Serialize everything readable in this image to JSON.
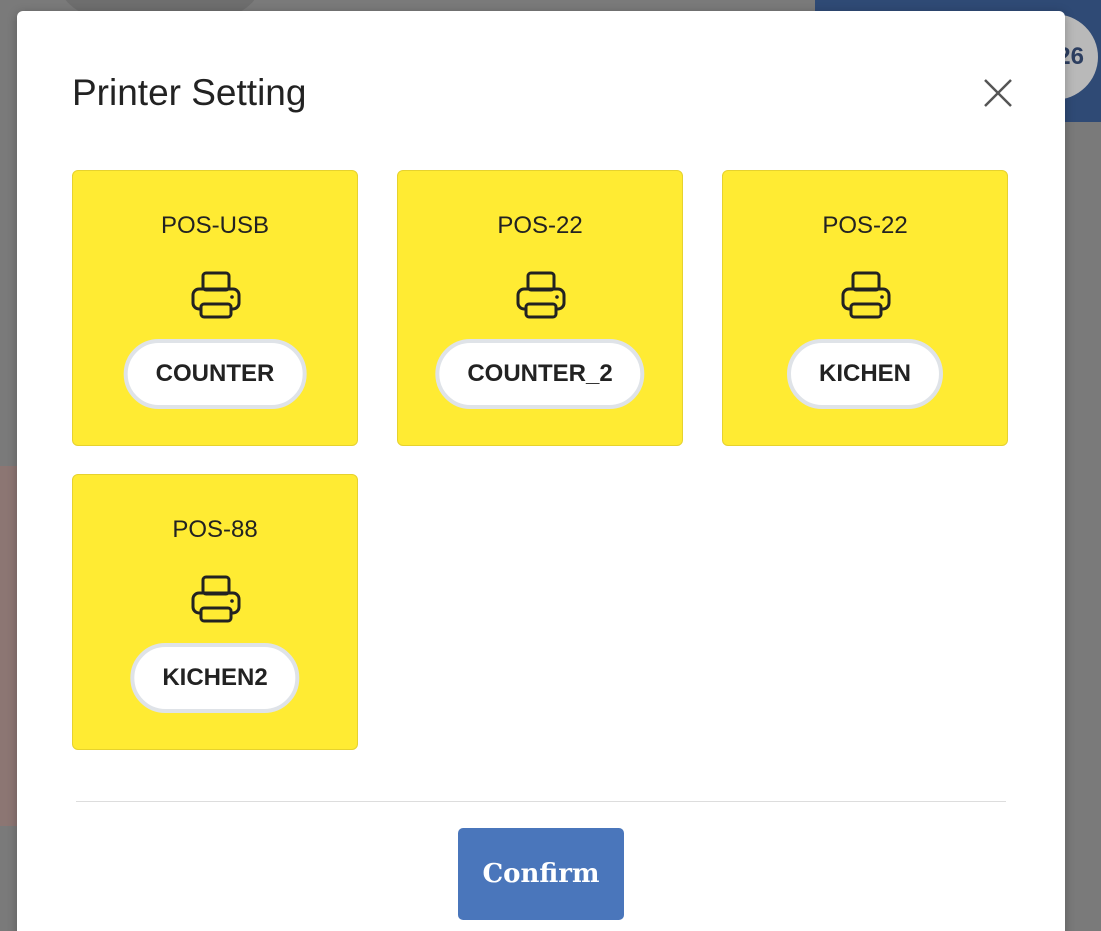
{
  "modal": {
    "title": "Printer Setting",
    "confirm_label": "Confirm"
  },
  "background": {
    "badge_text": "26"
  },
  "printers": [
    {
      "name": "POS-USB",
      "alias": "COUNTER"
    },
    {
      "name": "POS-22",
      "alias": "COUNTER_2"
    },
    {
      "name": "POS-22",
      "alias": "KICHEN"
    },
    {
      "name": "POS-88",
      "alias": "KICHEN2"
    }
  ],
  "colors": {
    "card_background": "#ffeb33",
    "confirm_button": "#4a76bb",
    "background_header": "#2f4a75"
  },
  "icons": {
    "printer": "printer-icon",
    "close": "close-icon"
  }
}
